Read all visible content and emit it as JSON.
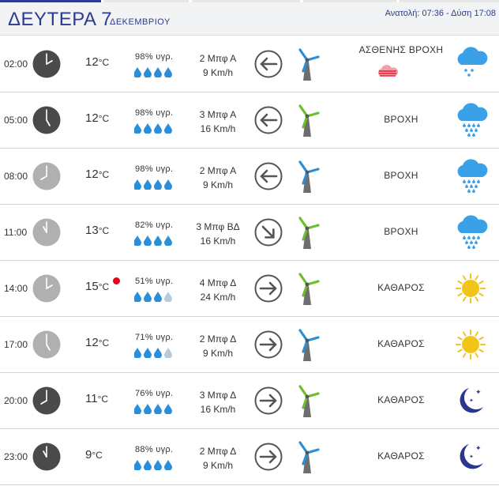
{
  "header": {
    "day": "ΔΕΥΤΕΡΑ 7",
    "month": "ΔΕΚΕΜΒΡΙΟΥ",
    "sun_info": "Ανατολή: 07:36 - Δύση 17:08"
  },
  "colors": {
    "accent": "#2b3b8f",
    "drop_blue": "#2a8fd9",
    "drop_gray": "#b9cbd9",
    "clock_night": "#4a4a4a",
    "clock_day": "#b0b0b0",
    "cloud_blue": "#3aa0e8",
    "sun_yellow": "#f2c318",
    "moon_navy": "#2a3791",
    "red_dot": "#e8001c"
  },
  "rows": [
    {
      "time": "02:00",
      "clock": "night",
      "hour": 2,
      "temp": "12",
      "unit": "°C",
      "humidity": "98% υγρ.",
      "drops_filled": 4,
      "wind_force": "2 Μπφ Α",
      "wind_speed": "9 Km/h",
      "arrow": "west",
      "mill": "blue",
      "condition": "ΑΣΘΕΝΗΣ ΒΡΟΧΗ",
      "rain_icon": "light-rain-icon",
      "icon": "cloud-light-rain-icon"
    },
    {
      "time": "05:00",
      "clock": "night",
      "hour": 5,
      "temp": "12",
      "unit": "°C",
      "humidity": "98% υγρ.",
      "drops_filled": 4,
      "wind_force": "3 Μπφ Α",
      "wind_speed": "16 Km/h",
      "arrow": "west",
      "mill": "green",
      "condition": "ΒΡΟΧΗ",
      "icon": "cloud-rain-icon"
    },
    {
      "time": "08:00",
      "clock": "day",
      "hour": 8,
      "temp": "12",
      "unit": "°C",
      "humidity": "98% υγρ.",
      "drops_filled": 4,
      "wind_force": "2 Μπφ Α",
      "wind_speed": "9 Km/h",
      "arrow": "west",
      "mill": "blue",
      "condition": "ΒΡΟΧΗ",
      "icon": "cloud-rain-icon"
    },
    {
      "time": "11:00",
      "clock": "day",
      "hour": 11,
      "temp": "13",
      "unit": "°C",
      "humidity": "82% υγρ.",
      "drops_filled": 4,
      "wind_force": "3 Μπφ ΒΔ",
      "wind_speed": "16 Km/h",
      "arrow": "southeast",
      "mill": "green",
      "condition": "ΒΡΟΧΗ",
      "icon": "cloud-rain-icon"
    },
    {
      "time": "14:00",
      "clock": "day",
      "hour": 2,
      "temp": "15",
      "unit": "°C",
      "humidity": "51% υγρ.",
      "drops_filled": 3,
      "wind_force": "4 Μπφ Δ",
      "wind_speed": "24 Km/h",
      "arrow": "east",
      "mill": "green",
      "condition": "ΚΑΘΑΡΟΣ",
      "icon": "sun-icon",
      "red_dot": true
    },
    {
      "time": "17:00",
      "clock": "day",
      "hour": 5,
      "temp": "12",
      "unit": "°C",
      "humidity": "71% υγρ.",
      "drops_filled": 3,
      "wind_force": "2 Μπφ Δ",
      "wind_speed": "9 Km/h",
      "arrow": "east",
      "mill": "blue",
      "condition": "ΚΑΘΑΡΟΣ",
      "icon": "sun-icon"
    },
    {
      "time": "20:00",
      "clock": "night",
      "hour": 8,
      "temp": "11",
      "unit": "°C",
      "humidity": "76% υγρ.",
      "drops_filled": 4,
      "wind_force": "3 Μπφ Δ",
      "wind_speed": "16 Km/h",
      "arrow": "east",
      "mill": "green",
      "condition": "ΚΑΘΑΡΟΣ",
      "icon": "moon-stars-icon"
    },
    {
      "time": "23:00",
      "clock": "night",
      "hour": 11,
      "temp": "9",
      "unit": "°C",
      "humidity": "88% υγρ.",
      "drops_filled": 4,
      "wind_force": "2 Μπφ Δ",
      "wind_speed": "9 Km/h",
      "arrow": "east",
      "mill": "blue",
      "condition": "ΚΑΘΑΡΟΣ",
      "icon": "moon-stars-icon"
    }
  ]
}
